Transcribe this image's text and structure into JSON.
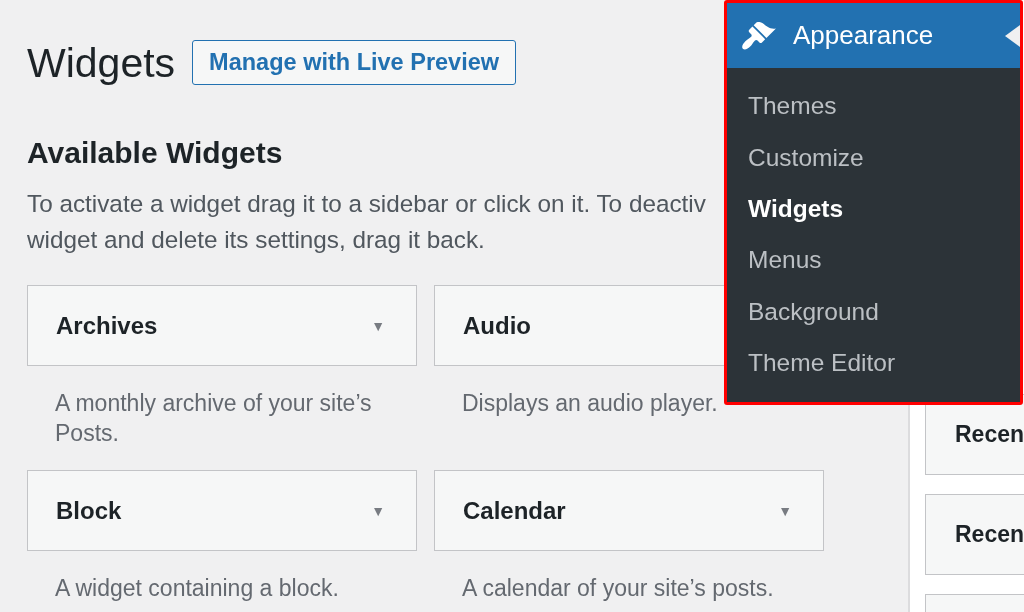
{
  "page": {
    "title": "Widgets",
    "action_button": "Manage with Live Preview"
  },
  "available_widgets": {
    "heading": "Available Widgets",
    "description_lines": [
      "To activate a widget drag it to a sidebar or click on it. To deactiv",
      "widget and delete its settings, drag it back."
    ],
    "widgets": [
      {
        "title": "Archives",
        "caret": "▼",
        "description": "A monthly archive of your site’s Posts."
      },
      {
        "title": "Audio",
        "description": "Displays an audio player."
      },
      {
        "title": "Block",
        "caret": "▼",
        "description": "A widget containing a block."
      },
      {
        "title": "Calendar",
        "caret": "▼",
        "description": "A calendar of your site’s posts."
      }
    ]
  },
  "sidebar_widgets": [
    {
      "title": "Recen"
    },
    {
      "title": "Recen"
    }
  ],
  "admin_menu": {
    "title": "Appearance",
    "current": true,
    "items": [
      {
        "label": "Themes",
        "selected": false
      },
      {
        "label": "Customize",
        "selected": false
      },
      {
        "label": "Widgets",
        "selected": true
      },
      {
        "label": "Menus",
        "selected": false
      },
      {
        "label": "Background",
        "selected": false
      },
      {
        "label": "Theme Editor",
        "selected": false
      }
    ]
  }
}
